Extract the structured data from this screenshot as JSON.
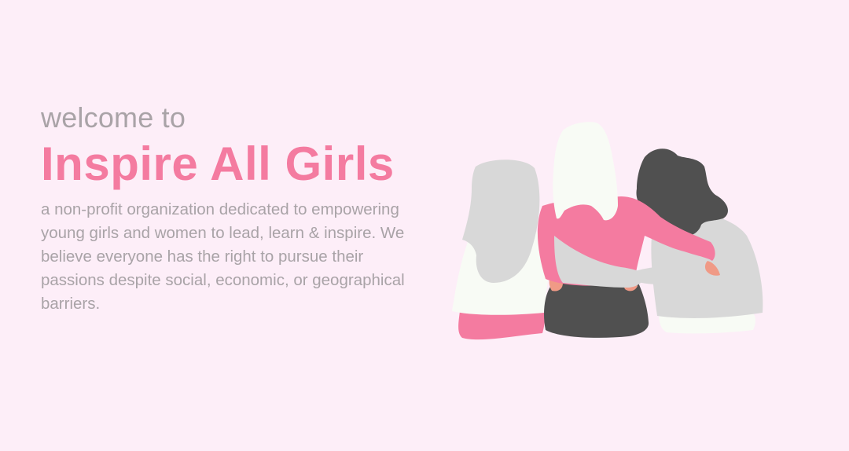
{
  "hero": {
    "welcome": "welcome to",
    "title": "Inspire All Girls",
    "description": "a non-profit organization dedicated to empowering young girls and women to lead, learn & inspire. We believe everyone has the right to pursue their passions despite social, economic, or geographical barriers."
  },
  "illustration": {
    "icon": "three-girls-hugging-illustration"
  },
  "colors": {
    "background": "#fdeef8",
    "accent_pink": "#f47ba0",
    "text_gray": "#a9a3a7",
    "hair_light_gray": "#d8d8d8",
    "hair_white": "#f8fbf5",
    "hair_dark": "#505050",
    "skin": "#f09a86"
  }
}
